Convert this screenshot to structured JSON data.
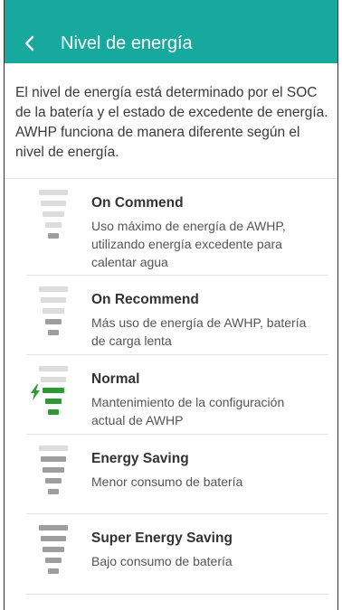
{
  "header": {
    "title": "Nivel de energía",
    "background_color": "#17a89e",
    "back_icon": "chevron-left-icon"
  },
  "intro": {
    "text": "El nivel de energía está determinado por el SOC de la batería y el estado de excedente de energía. AWHP funciona de manera diferente según el nivel de energía."
  },
  "levels": [
    {
      "name": "On Commend",
      "description": "Uso máximo de energía de AWHP, utilizando energía excedente para calentar agua",
      "active_bars": 1,
      "active": false
    },
    {
      "name": "On Recommend",
      "description": "Más uso de energía de AWHP, batería de carga lenta",
      "active_bars": 2,
      "active": false
    },
    {
      "name": "Normal",
      "description": "Mantenimiento de la configuración actual de AWHP",
      "active_bars": 3,
      "active": true,
      "icon": "lightning-bolt-icon"
    },
    {
      "name": "Energy Saving",
      "description": "Menor consumo de batería",
      "active_bars": 4,
      "active": false
    },
    {
      "name": "Super Energy Saving",
      "description": "Bajo consumo de batería",
      "active_bars": 5,
      "active": false
    }
  ],
  "colors": {
    "bar_inactive": "#dcdcdc",
    "bar_active": "#9e9e9e",
    "bar_current": "#2e9a35"
  }
}
